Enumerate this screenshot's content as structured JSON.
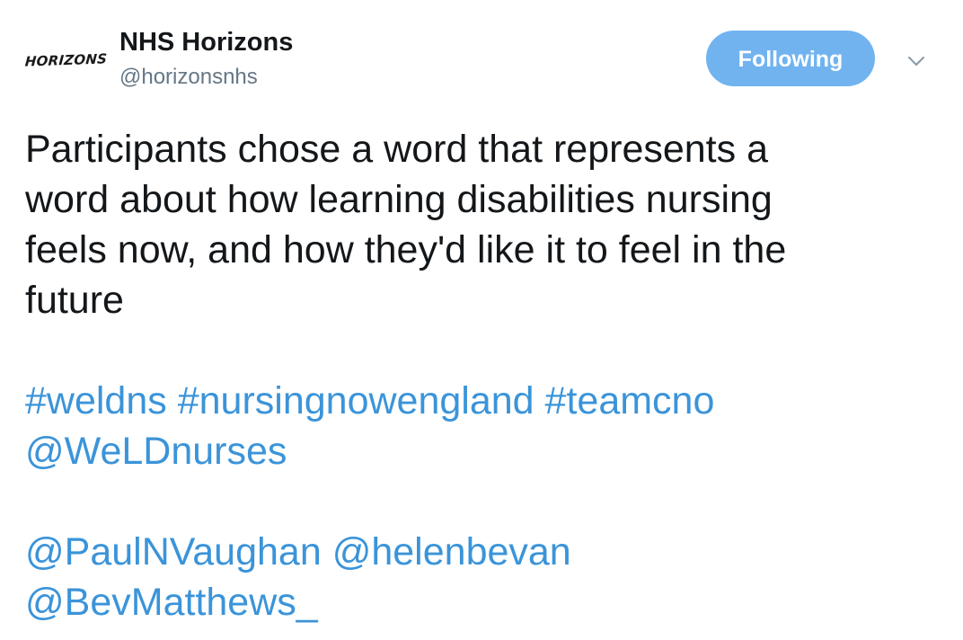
{
  "user": {
    "avatar_text": "HORIZONS",
    "display_name": "NHS Horizons",
    "handle": "@horizonsnhs"
  },
  "follow_button": {
    "label": "Following"
  },
  "icons": {
    "menu": "chevron-down-icon"
  },
  "colors": {
    "follow_button_bg": "#71b3ef",
    "link": "#3b94d9",
    "handle": "#657786",
    "text": "#14171a"
  },
  "tweet": {
    "text_lines": [
      "Participants chose a word that represents a",
      "word about how learning disabilities nursing",
      "feels now, and how they'd like it to feel in the",
      "future"
    ],
    "hashtags": [
      "#weldns",
      "#nursingnowengland",
      "#teamcno"
    ],
    "mention_weldnurses": "@WeLDnurses",
    "mentions_line": [
      "@PaulNVaughan",
      "@helenbevan"
    ],
    "mention_bevmatthews": "@BevMatthews_"
  }
}
